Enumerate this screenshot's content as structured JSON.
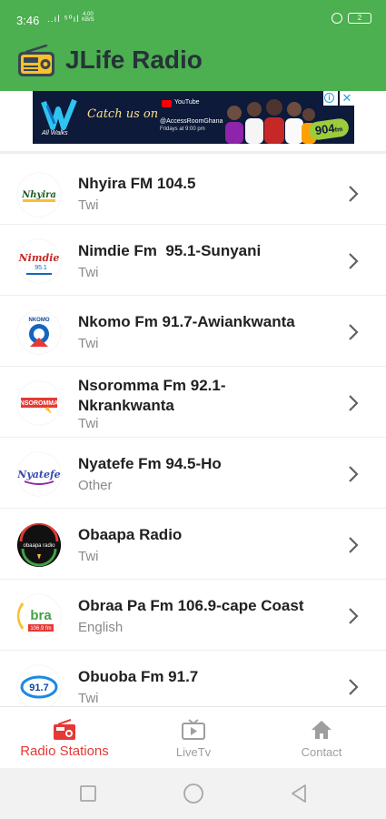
{
  "status_bar": {
    "time": "3:46",
    "signal": "..ıl ⁵⁰ıl",
    "net_speed": "4.00",
    "net_unit": "KB/S",
    "battery": "2"
  },
  "app_bar": {
    "title": "JLife Radio",
    "icon": "radio-icon"
  },
  "ad": {
    "logo_text": "All Walks",
    "catch_text": "Catch us on",
    "youtube_label": "YouTube",
    "handle": "@AccessRoomGhana",
    "time_text": "Fridays at 9:00 pm",
    "badge_number": "904",
    "badge_sub": "fm"
  },
  "stations": [
    {
      "name": "Nhyira FM 104.5",
      "language": "Twi"
    },
    {
      "name": "Nimdie Fm  95.1-Sunyani",
      "language": "Twi"
    },
    {
      "name": "Nkomo Fm 91.7-Awiankwanta",
      "language": "Twi"
    },
    {
      "name": "Nsoromma Fm 92.1-\nNkrankwanta",
      "language": "Twi"
    },
    {
      "name": "Nyatefe Fm 94.5-Ho",
      "language": "Other"
    },
    {
      "name": "Obaapa Radio",
      "language": "Twi"
    },
    {
      "name": "Obraa Pa Fm 106.9-cape Coast",
      "language": "English"
    },
    {
      "name": "Obuoba Fm 91.7",
      "language": "Twi"
    }
  ],
  "bottom_nav": {
    "items": [
      {
        "label": "Radio Stations",
        "icon": "radio-icon"
      },
      {
        "label": "LiveTv",
        "icon": "tv-icon"
      },
      {
        "label": "Contact",
        "icon": "home-icon"
      }
    ]
  },
  "colors": {
    "app_bar": "#4caf50",
    "active_nav": "#e53935",
    "inactive_nav": "#9e9e9e"
  }
}
